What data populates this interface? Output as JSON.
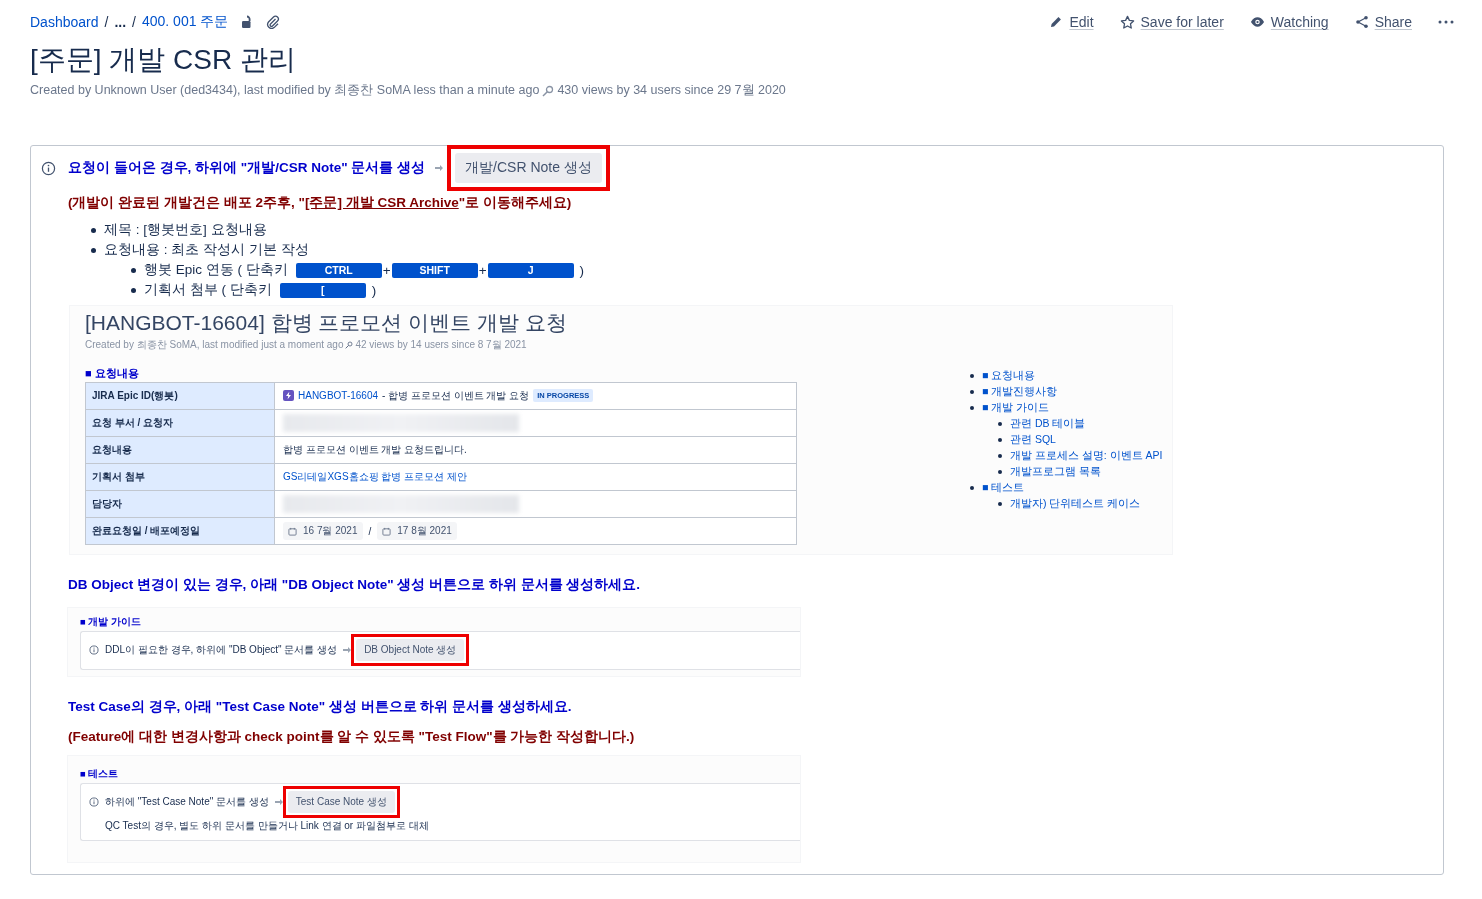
{
  "breadcrumbs": [
    {
      "text": "Dashboard",
      "kind": "link"
    },
    {
      "text": "/",
      "kind": "sep"
    },
    {
      "text": "...",
      "kind": "ellipsis"
    },
    {
      "text": "/",
      "kind": "sep"
    },
    {
      "text": "400. 001 주문",
      "kind": "link"
    }
  ],
  "actions": [
    {
      "label": "Edit"
    },
    {
      "label": "Save for later"
    },
    {
      "label": "Watching"
    },
    {
      "label": "Share"
    }
  ],
  "title": "[주문] 개발 CSR 관리",
  "byline": "Created by Unknown User (ded3434), last modified by 최종찬 SoMA less than a minute ago",
  "views": "430 views by 34 users since 29 7월 2020",
  "panel": {
    "intro": "요청이 들어온 경우, 하위에 \"개발/CSR Note\" 문서를 생성",
    "intro_button": {
      "label": "개발/CSR Note 생성",
      "highlighted": true
    },
    "notice_before": "(개발이 완료된 개발건은 배포 2주후, \"",
    "notice_link": "[주문] 개발 CSR Archive",
    "notice_after": "\"로 이동해주세요)",
    "bullets": [
      {
        "text": "제목 : [행봇번호] 요청내용"
      },
      {
        "text": "요청내용 : 최초 작성시 기본 작성",
        "children": [
          {
            "text": "행봇 Epic 연동 ( 단축키",
            "keys": [
              {
                "label": "CTRL"
              },
              {
                "label": "SHIFT",
                "joiner": "+"
              },
              {
                "label": "J",
                "joiner": "+"
              }
            ],
            "suffix": ")"
          },
          {
            "text": "기획서 첨부 ( 단축키",
            "keys": [
              {
                "label": "["
              }
            ],
            "suffix": ")"
          }
        ]
      }
    ],
    "example": {
      "title": "[HANGBOT-16604] 합병 프로모션 이벤트 개발 요청",
      "meta": "Created by 최종찬 SoMA, last modified just a moment ago",
      "views": "42 views by 14 users since 8 7월 2021",
      "section": "■ 요청내용",
      "rows": [
        {
          "label": "JIRA Epic ID(행봇)",
          "kind": "epic",
          "key": "HANGBOT-16604",
          "summary": "- 합병 프로모션 이벤트 개발 요청",
          "status": "IN PROGRESS"
        },
        {
          "label": "요청 부서 / 요청자",
          "kind": "blurred"
        },
        {
          "label": "요청내용",
          "kind": "text",
          "text": "합병 프로모션 이벤트 개발 요청드립니다."
        },
        {
          "label": "기획서 첨부",
          "kind": "link",
          "text": "GS리테일XGS홈쇼핑 합병 프로모션 제안"
        },
        {
          "label": "담당자",
          "kind": "blurred"
        },
        {
          "label": "완료요청일 / 배포예정일",
          "kind": "dates",
          "dates": [
            "16 7월 2021",
            "17 8월 2021"
          ],
          "separator": "/"
        }
      ],
      "toc": [
        {
          "text": "■ 요청내용"
        },
        {
          "text": "■ 개발진행사항"
        },
        {
          "text": "■ 개발 가이드",
          "children": [
            {
              "text": "관련 DB 테이블"
            },
            {
              "text": "관련 SQL"
            },
            {
              "text": "개발 프로세스 설명: 이벤트 API"
            },
            {
              "text": "개발프로그램 목록"
            }
          ]
        },
        {
          "text": "■ 테스트",
          "children": [
            {
              "text": "개발자) 단위테스트 케이스"
            }
          ]
        }
      ]
    },
    "db_heading": "DB Object 변경이 있는 경우, 아래 \"DB Object Note\" 생성 버튼으로 하위 문서를 생성하세요.",
    "db_example": {
      "section": "■ 개발 가이드",
      "info": "DDL이 필요한 경우, 하위에 \"DB Object\" 문서를 생성",
      "button": {
        "label": "DB Object Note 생성",
        "highlighted": true
      }
    },
    "test_heading": "Test Case의 경우, 아래 \"Test Case Note\" 생성 버튼으로 하위 문서를 생성하세요.",
    "test_notice": "(Feature에 대한 변경사항과 check point를 알 수 있도록 \"Test Flow\"를 가능한 작성합니다.)",
    "test_example": {
      "section": "■ 테스트",
      "info": "하위에 \"Test Case Note\" 문서를 생성",
      "button": {
        "label": "Test Case Note 생성",
        "highlighted": true
      },
      "note": "QC Test의 경우, 별도 하위 문서를 만들거나 Link 연결 or 파일첨부로 대체"
    }
  }
}
